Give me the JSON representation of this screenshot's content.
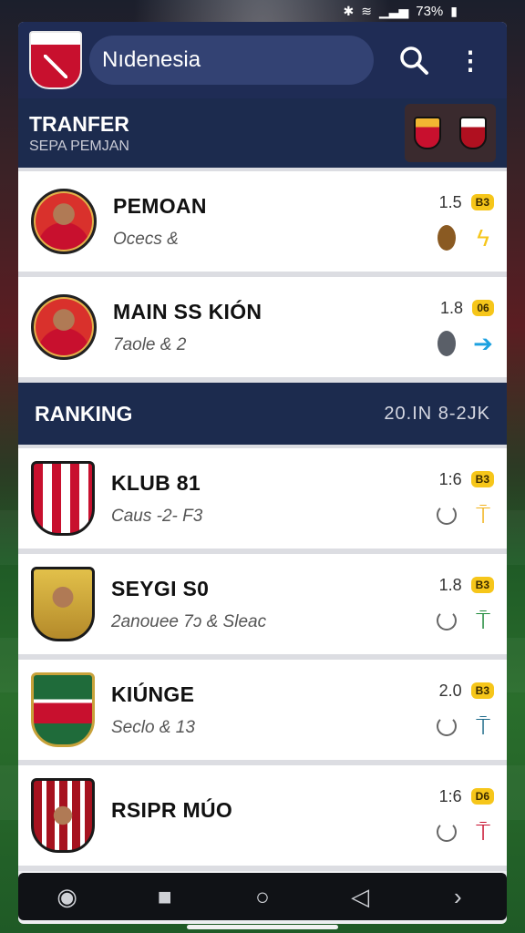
{
  "status_bar": {
    "battery": "73%"
  },
  "header": {
    "title": "Nıdenesia"
  },
  "transfer": {
    "title": "TRANFER",
    "subtitle": "SEPA PEMJAN"
  },
  "transfer_items": [
    {
      "name": "PEMOAN",
      "detail": "Ocecs &",
      "value": "1.5",
      "badge": "B3",
      "icon_a": "brown-oval-icon",
      "icon_b": "lightning-icon",
      "accent": "#f6c61a"
    },
    {
      "name": "MAIN SS KIÓN",
      "detail": "7aole &  2",
      "value": "1.8",
      "badge": "06",
      "icon_a": "grey-oval-icon",
      "icon_b": "arrow-right-icon",
      "accent": "#1da1e0"
    }
  ],
  "ranking": {
    "title": "RANKING",
    "range": "20.IN 8-2ЈK"
  },
  "ranking_items": [
    {
      "name": "KLUB 81",
      "detail": "Caus -2- F3",
      "value": "1:6",
      "badge": "B3",
      "crest": "red",
      "accent": "#f2b21a"
    },
    {
      "name": "SEYGI S0",
      "detail": "2anouee 7ɔ & Sleac",
      "value": "1.8",
      "badge": "B3",
      "crest": "gold",
      "accent": "#1f8a3a"
    },
    {
      "name": "KIÚNGE",
      "detail": "Seclo & 13",
      "value": "2.0",
      "badge": "B3",
      "crest": "green",
      "accent": "#1f6b8a"
    },
    {
      "name": "RSIPR MÚO",
      "detail": "",
      "value": "1:6",
      "badge": "D6",
      "crest": "dark",
      "accent": "#c8102e"
    }
  ],
  "colors": {
    "header_bg": "#1f2c55",
    "badge": "#f6c61a",
    "page_bg": "#eeeff2"
  }
}
